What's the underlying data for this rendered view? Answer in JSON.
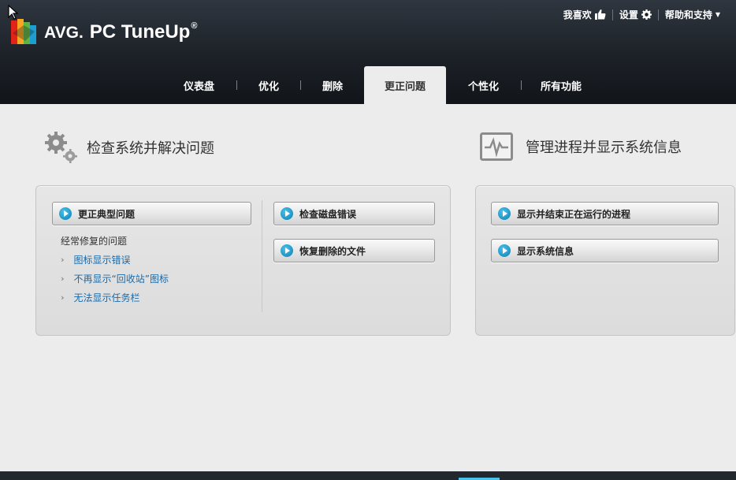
{
  "app": {
    "brand_avg": "AVG.",
    "brand_product": "PC TuneUp",
    "brand_reg": "®"
  },
  "topnav": {
    "like_label": "我喜欢",
    "settings_label": "设置",
    "help_label": "帮助和支持"
  },
  "tabs": [
    {
      "label": "仪表盘",
      "active": false
    },
    {
      "label": "优化",
      "active": false
    },
    {
      "label": "删除",
      "active": false
    },
    {
      "label": "更正问题",
      "active": true
    },
    {
      "label": "个性化",
      "active": false
    },
    {
      "label": "所有功能",
      "active": false
    }
  ],
  "left_section": {
    "title": "检查系统并解决问题",
    "fix_common_button": "更正典型问题",
    "common_issues_label": "经常修复的问题",
    "issues": [
      "图标显示错误",
      "不再显示“回收站”图标",
      "无法显示任务栏"
    ],
    "check_disk_button": "检查磁盘错误",
    "restore_files_button": "恢复删除的文件"
  },
  "right_section": {
    "title": "管理进程并显示系统信息",
    "show_processes_button": "显示并结束正在运行的进程",
    "system_info_button": "显示系统信息"
  },
  "colors": {
    "accent": "#1b9fd3",
    "link": "#1b6aa8",
    "header_bg": "#1c2127"
  }
}
